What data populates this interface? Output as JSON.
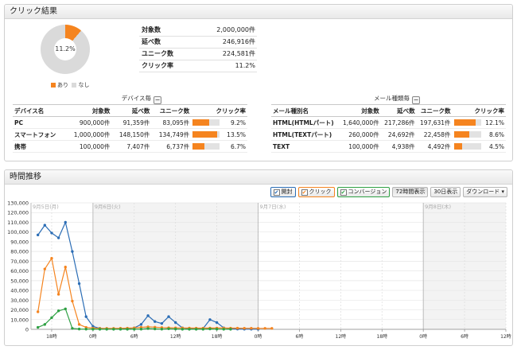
{
  "results_panel": {
    "title": "クリック結果",
    "donut": {
      "center_label": "11.2%",
      "fraction": 0.112,
      "colors": {
        "yes": "#f5841f",
        "no": "#dadada"
      }
    },
    "legend": {
      "yes": "あり",
      "no": "なし"
    },
    "summary": [
      {
        "label": "対象数",
        "value": "2,000,000",
        "unit": "件"
      },
      {
        "label": "延べ数",
        "value": "246,916",
        "unit": "件"
      },
      {
        "label": "ユニーク数",
        "value": "224,581",
        "unit": "件"
      },
      {
        "label": "クリック率",
        "value": "11.2",
        "unit": "%"
      }
    ],
    "device_table": {
      "title": "デバイス毎",
      "toggle": "−",
      "headers": [
        "デバイス名",
        "対象数",
        "延べ数",
        "ユニーク数",
        "クリック率"
      ],
      "rows": [
        {
          "name": "PC",
          "target": "900,000件",
          "total": "91,359件",
          "unique": "83,095件",
          "rate_fraction": 0.092,
          "rate": "9.2%"
        },
        {
          "name": "スマートフォン",
          "target": "1,000,000件",
          "total": "148,150件",
          "unique": "134,749件",
          "rate_fraction": 0.135,
          "rate": "13.5%"
        },
        {
          "name": "携帯",
          "target": "100,000件",
          "total": "7,407件",
          "unique": "6,737件",
          "rate_fraction": 0.067,
          "rate": "6.7%"
        }
      ]
    },
    "mail_table": {
      "title": "メール種類毎",
      "toggle": "−",
      "headers": [
        "メール種別名",
        "対象数",
        "延べ数",
        "ユニーク数",
        "クリック率"
      ],
      "rows": [
        {
          "name": "HTML(HTMLパート)",
          "target": "1,640,000件",
          "total": "217,286件",
          "unique": "197,631件",
          "rate_fraction": 0.121,
          "rate": "12.1%"
        },
        {
          "name": "HTML(TEXTパート)",
          "target": "260,000件",
          "total": "24,692件",
          "unique": "22,458件",
          "rate_fraction": 0.086,
          "rate": "8.6%"
        },
        {
          "name": "TEXT",
          "target": "100,000件",
          "total": "4,938件",
          "unique": "4,492件",
          "rate_fraction": 0.045,
          "rate": "4.5%"
        }
      ]
    }
  },
  "time_panel": {
    "title": "時間推移",
    "toolbar": {
      "open": "開封",
      "click": "クリック",
      "conversion": "コンバージョン",
      "check_mark": "✔",
      "range_72h": "72時間表示",
      "range_30d": "30日表示",
      "download": "ダウンロード ▾"
    },
    "colors": {
      "open": "#2b6db5",
      "click": "#f5841f",
      "conversion": "#2ea043"
    }
  },
  "chart_data": {
    "type": "line",
    "y_ticks": [
      "0",
      "10,000",
      "20,000",
      "30,000",
      "40,000",
      "50,000",
      "60,000",
      "70,000",
      "80,000",
      "90,000",
      "100,000",
      "110,000",
      "120,000",
      "130,000"
    ],
    "ylim": [
      0,
      130000
    ],
    "x_range_hours": [
      15,
      84
    ],
    "x_ticks": [
      {
        "hour": 18,
        "label": "18時"
      },
      {
        "hour": 24,
        "label": "0時"
      },
      {
        "hour": 30,
        "label": "6時"
      },
      {
        "hour": 36,
        "label": "12時"
      },
      {
        "hour": 42,
        "label": "18時"
      },
      {
        "hour": 48,
        "label": "0時"
      },
      {
        "hour": 54,
        "label": "6時"
      },
      {
        "hour": 60,
        "label": "12時"
      },
      {
        "hour": 66,
        "label": "18時"
      },
      {
        "hour": 72,
        "label": "0時"
      },
      {
        "hour": 78,
        "label": "6時"
      },
      {
        "hour": 84,
        "label": "12時"
      }
    ],
    "day_markers": [
      {
        "hour": 15,
        "label": "9月5日(月)"
      },
      {
        "hour": 24,
        "label": "9月6日(火)"
      },
      {
        "hour": 48,
        "label": "9月7日(水)"
      },
      {
        "hour": 72,
        "label": "9月8日(木)"
      }
    ],
    "series": [
      {
        "name": "開封",
        "color": "#2b6db5",
        "x": [
          16,
          17,
          18,
          19,
          20,
          21,
          22,
          23,
          24,
          25,
          26,
          27,
          28,
          29,
          30,
          31,
          32,
          33,
          34,
          35,
          36,
          37,
          38,
          39,
          40,
          41,
          42,
          43,
          44,
          45,
          46,
          47,
          48
        ],
        "y": [
          97000,
          107000,
          99000,
          94000,
          110000,
          80000,
          47000,
          13000,
          3000,
          1000,
          500,
          300,
          300,
          400,
          1500,
          5000,
          14000,
          8000,
          6000,
          13000,
          7000,
          1500,
          500,
          300,
          800,
          10000,
          7000,
          1500,
          500,
          300,
          200,
          200,
          150
        ]
      },
      {
        "name": "クリック",
        "color": "#f5841f",
        "x": [
          16,
          17,
          18,
          19,
          20,
          21,
          22,
          23,
          24,
          25,
          26,
          27,
          28,
          29,
          30,
          31,
          32,
          33,
          34,
          35,
          36,
          37,
          38,
          39,
          40,
          41,
          42,
          43,
          44,
          45,
          46,
          47,
          48,
          49,
          50
        ],
        "y": [
          18000,
          62000,
          73000,
          36000,
          64000,
          29000,
          5000,
          2000,
          1200,
          1000,
          1000,
          1000,
          1100,
          1200,
          1500,
          2000,
          2500,
          2200,
          1800,
          1600,
          1500,
          1400,
          1300,
          1200,
          1200,
          1300,
          1300,
          1300,
          1200,
          1200,
          1100,
          1100,
          1000,
          1000,
          1000
        ]
      },
      {
        "name": "コンバージョン",
        "color": "#2ea043",
        "x": [
          16,
          17,
          18,
          19,
          20,
          21,
          22,
          23,
          24,
          25,
          26,
          27,
          28,
          29,
          30,
          31,
          32,
          33,
          34,
          35,
          36,
          37,
          38,
          39,
          40,
          41,
          42,
          43,
          44
        ],
        "y": [
          2000,
          5000,
          12000,
          19000,
          21000,
          1000,
          300,
          200,
          100,
          100,
          100,
          100,
          100,
          100,
          100,
          200,
          800,
          400,
          200,
          600,
          300,
          100,
          100,
          100,
          100,
          400,
          200,
          100,
          100
        ]
      }
    ]
  }
}
